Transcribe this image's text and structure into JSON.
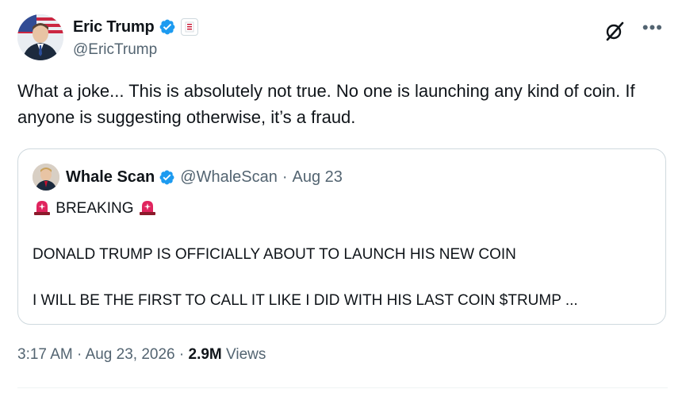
{
  "author": {
    "display_name": "Eric Trump",
    "handle": "@EricTrump"
  },
  "tweet": {
    "text": "What a joke... This is absolutely not true. No one is launching any kind of coin. If anyone is suggesting otherwise, it’s a fraud."
  },
  "quoted": {
    "display_name": "Whale Scan",
    "handle": "@WhaleScan",
    "separator": "·",
    "date": "Aug 23",
    "line1": "BREAKING",
    "line2": "DONALD TRUMP IS OFFICIALLY ABOUT TO LAUNCH HIS NEW COIN",
    "line3": "I WILL BE THE FIRST TO CALL IT LIKE I DID WITH HIS LAST COIN $TRUMP ..."
  },
  "meta": {
    "time": "3:17 AM",
    "sep1": "·",
    "date": "Aug 23, 2026",
    "sep2": "·",
    "views_count": "2.9M",
    "views_label": "Views"
  },
  "icons": {
    "verified": "verified-badge-icon",
    "affiliate": "government-affiliation-icon",
    "grok": "grok-icon",
    "more": "more-options-icon",
    "siren": "police-light-emoji-icon"
  },
  "colors": {
    "verified_blue": "#1d9bf0",
    "secondary_text": "#536471",
    "border": "#cfd9de",
    "siren_red": "#e0245e"
  }
}
